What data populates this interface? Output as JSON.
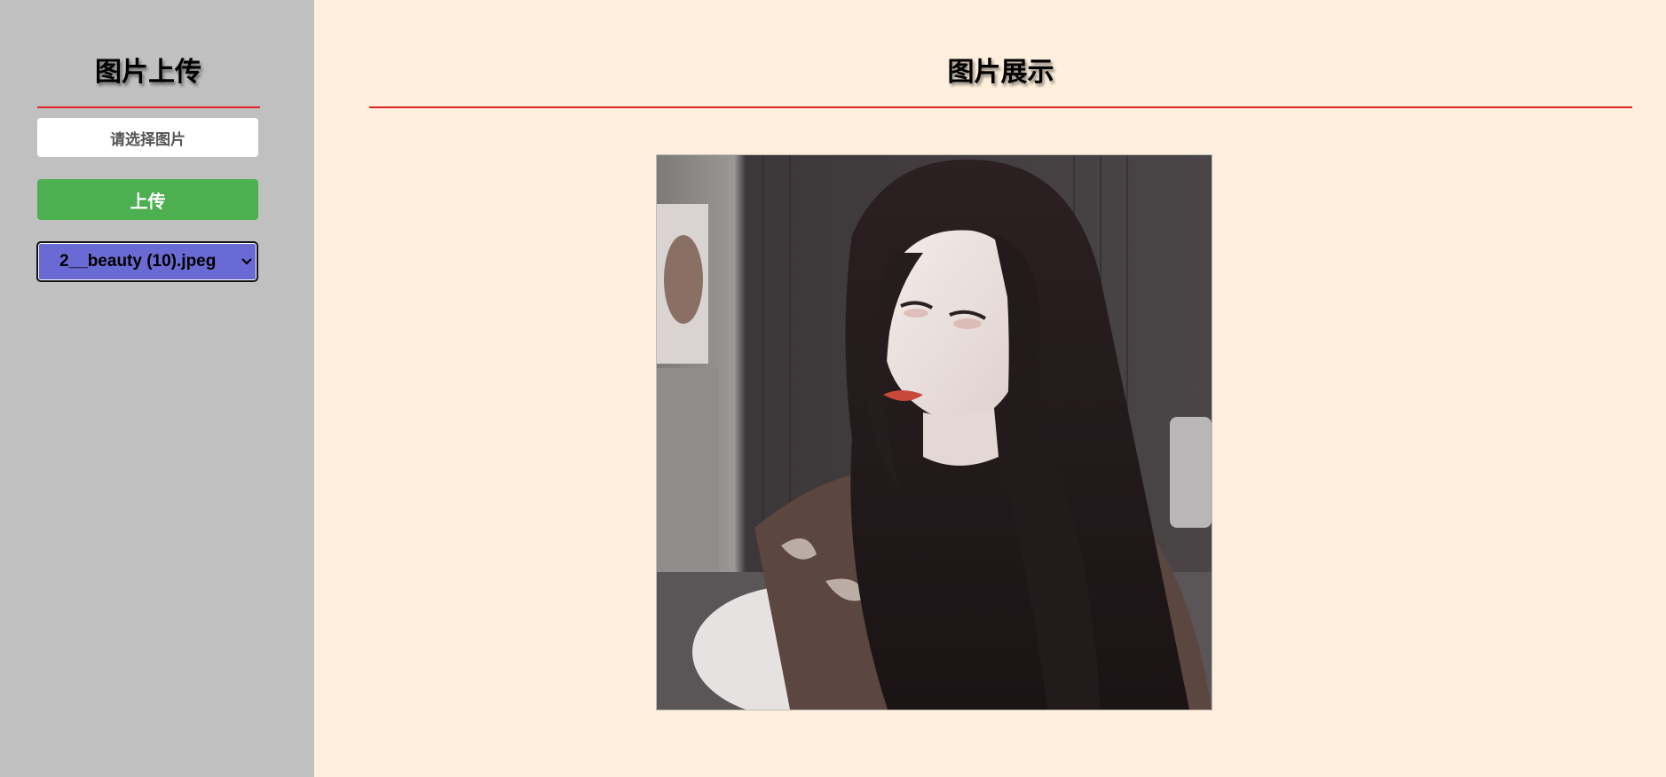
{
  "sidebar": {
    "title": "图片上传",
    "file_button_label": "请选择图片",
    "upload_button_label": "上传",
    "image_select": {
      "selected": "2__beauty (10).jpeg"
    }
  },
  "main": {
    "title": "图片展示",
    "photo": {
      "subject": "portrait-photo"
    }
  },
  "colors": {
    "sidebar_bg": "#c0c0c0",
    "main_bg": "#ffefdc",
    "divider": "#e02424",
    "upload_button": "#4caf50",
    "select_bg": "#6a6ad4"
  }
}
